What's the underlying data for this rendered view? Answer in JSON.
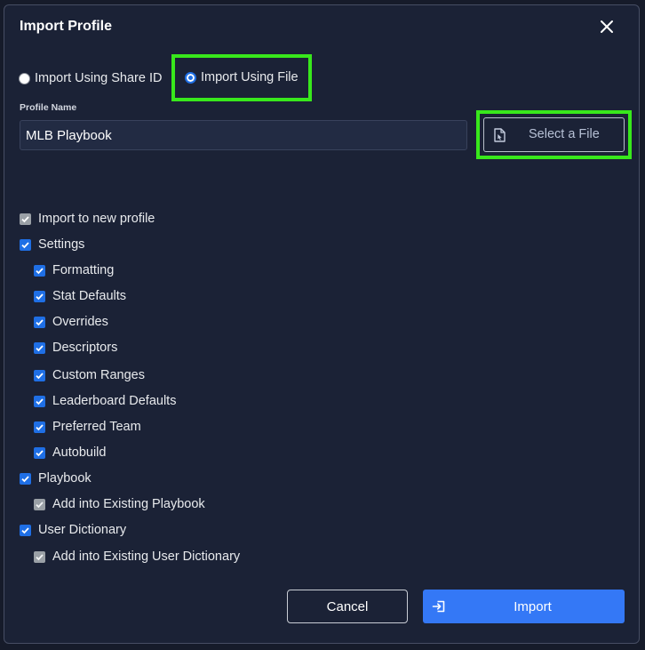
{
  "dialog": {
    "title": "Import Profile",
    "close_icon": "close-icon"
  },
  "import_mode": {
    "options": [
      {
        "label": "Import Using Share ID",
        "selected": false
      },
      {
        "label": "Import Using File",
        "selected": true
      }
    ]
  },
  "profile_name": {
    "label": "Profile Name",
    "value": "MLB Playbook"
  },
  "select_file_button": {
    "label": "Select a File",
    "icon": "file-icon"
  },
  "import_options": [
    {
      "label": "Import to new profile",
      "checked": true,
      "disabled": true
    },
    {
      "label": "Settings",
      "checked": true,
      "disabled": false,
      "children": [
        {
          "label": "Formatting",
          "checked": true,
          "disabled": false
        },
        {
          "label": "Stat Defaults",
          "checked": true,
          "disabled": false
        },
        {
          "label": "Overrides",
          "checked": true,
          "disabled": false
        },
        {
          "label": "Descriptors",
          "checked": true,
          "disabled": false
        },
        {
          "label": "Custom Ranges",
          "checked": true,
          "disabled": false
        },
        {
          "label": "Leaderboard Defaults",
          "checked": true,
          "disabled": false
        },
        {
          "label": "Preferred Team",
          "checked": true,
          "disabled": false
        },
        {
          "label": "Autobuild",
          "checked": true,
          "disabled": false
        }
      ]
    },
    {
      "label": "Playbook",
      "checked": true,
      "disabled": false,
      "children": [
        {
          "label": "Add into Existing Playbook",
          "checked": true,
          "disabled": true
        }
      ]
    },
    {
      "label": "User Dictionary",
      "checked": true,
      "disabled": false,
      "children": [
        {
          "label": "Add into Existing User Dictionary",
          "checked": true,
          "disabled": true
        }
      ]
    }
  ],
  "actions": {
    "cancel_label": "Cancel",
    "import_label": "Import",
    "import_icon": "import-icon"
  },
  "colors": {
    "background": "#1b2236",
    "input_background": "#222b43",
    "accent": "#3478f6",
    "highlight": "#38e81c",
    "checkbox_checked": "#1f6fe5",
    "checkbox_disabled": "#9aa0a6"
  }
}
